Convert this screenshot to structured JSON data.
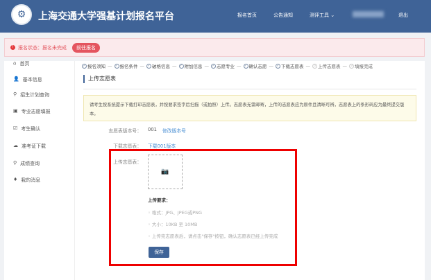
{
  "header": {
    "title": "上海交通大学强基计划报名平台",
    "nav": [
      "报名首页",
      "公告通知",
      "测评工具",
      "退出"
    ]
  },
  "alert": {
    "text": "报名状态：报名未完成",
    "button": "前往报名"
  },
  "sidebar": {
    "items": [
      {
        "icon": "home-icon",
        "glyph": "⌂",
        "label": "首页"
      },
      {
        "icon": "user-icon",
        "glyph": "👤",
        "label": "基本信息"
      },
      {
        "icon": "search-icon",
        "glyph": "⚲",
        "label": "招生计划查询"
      },
      {
        "icon": "book-icon",
        "glyph": "▣",
        "label": "专业志愿填报"
      },
      {
        "icon": "edit-icon",
        "glyph": "☑",
        "label": "考生确认"
      },
      {
        "icon": "cloud-download-icon",
        "glyph": "☁",
        "label": "准考证下载"
      },
      {
        "icon": "search-icon",
        "glyph": "⚲",
        "label": "成绩查询"
      },
      {
        "icon": "bell-icon",
        "glyph": "♦",
        "label": "我的消息"
      }
    ]
  },
  "steps": [
    {
      "label": "报名须知",
      "done": true
    },
    {
      "label": "报名条件",
      "done": true
    },
    {
      "label": "破格信息",
      "done": true
    },
    {
      "label": "附加信息",
      "done": true
    },
    {
      "label": "志愿专业",
      "done": true
    },
    {
      "label": "确认志愿",
      "done": true
    },
    {
      "label": "下载志愿表",
      "done": true
    },
    {
      "label": "上传志愿表",
      "done": false,
      "num": "8"
    },
    {
      "label": "填报完成",
      "done": false,
      "num": "9"
    }
  ],
  "page": {
    "title": "上传志愿表",
    "notice": "请考生按系统提示下载打印志愿表，并按要求签字后扫描（或拍照）上传。志愿表无需邮寄，上传的志愿表应为原件且清晰可辨，志愿表上的条形码应为最终提交版本。",
    "version_label": "志愿表版本号：",
    "version": "001",
    "modify_link": "修改版本号",
    "download_label": "下载志愿表：",
    "download_link": "下载001版本",
    "upload_label": "上传志愿表：",
    "req_title": "上传要求：",
    "reqs": [
      "◦ 格式：JPG、JPEG或PNG",
      "◦ 大小：10KB 至 10MB",
      "◦ 上传完志愿表后，请点击\"保存\"按钮，确认志愿表已经上传完成"
    ],
    "save": "保存"
  }
}
